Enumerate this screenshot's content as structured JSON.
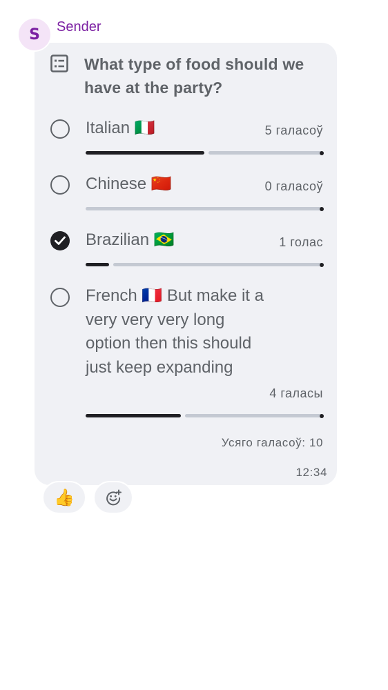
{
  "message": {
    "sender_initial": "S",
    "sender_name": "Sender",
    "time": "12:34"
  },
  "poll": {
    "icon": "poll-icon",
    "question": "What type of food should we have at the party?",
    "options": [
      {
        "label": "Italian 🇮🇹",
        "votes_text": "5 галасоў",
        "votes": 5,
        "fraction": 0.5,
        "selected": false
      },
      {
        "label": "Chinese 🇨🇳",
        "votes_text": "0 галасоў",
        "votes": 0,
        "fraction": 0.0,
        "selected": false
      },
      {
        "label": "Brazilian 🇧🇷",
        "votes_text": "1 голас",
        "votes": 1,
        "fraction": 0.1,
        "selected": true
      },
      {
        "label": "French 🇫🇷 But make it a very very very long option then this should just keep expanding",
        "votes_text": "4 галасы",
        "votes": 4,
        "fraction": 0.4,
        "selected": false
      }
    ],
    "total_text": "Усяго галасоў: 10"
  },
  "reactions": {
    "thumb": "👍",
    "add_icon": "add-reaction-icon"
  },
  "colors": {
    "accent": "#7b1fa2",
    "avatar_bg": "#f4e4f7",
    "bubble_bg": "#f0f1f5",
    "bar_fill": "#1f1f23",
    "bar_track": "#c4c9d2",
    "text": "#5f6368"
  }
}
